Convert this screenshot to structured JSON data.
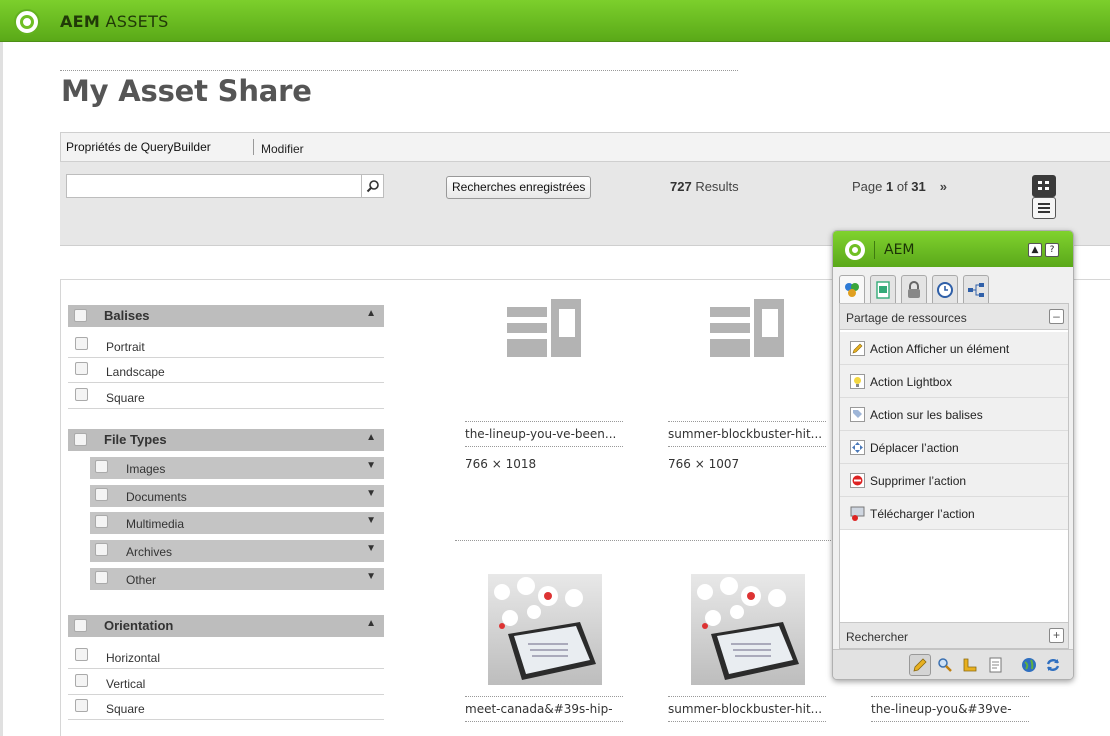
{
  "app": {
    "title_bold": "AEM",
    "title_rest": " ASSETS"
  },
  "page": {
    "title": "My Asset Share"
  },
  "query_builder": {
    "title": "Propriétés de QueryBuilder",
    "edit_label": "Modifier"
  },
  "search": {
    "value": "",
    "placeholder": "",
    "saved_searches_label": "Recherches enregistrées",
    "results_count": "727",
    "results_label": " Results",
    "page_prefix": "Page ",
    "page_current": "1",
    "page_of": " of ",
    "page_total": "31",
    "next_label": "»"
  },
  "facets": {
    "tags": {
      "label": "Balises",
      "items": [
        "Portrait",
        "Landscape",
        "Square"
      ]
    },
    "file_types": {
      "label": "File Types",
      "items": [
        "Images",
        "Documents",
        "Multimedia",
        "Archives",
        "Other"
      ]
    },
    "orientation": {
      "label": "Orientation",
      "items": [
        "Horizontal",
        "Vertical",
        "Square"
      ]
    }
  },
  "assets": [
    {
      "name": "the-lineup-you-ve-been...",
      "dims": "766 × 1018"
    },
    {
      "name": "summer-blockbuster-hit...",
      "dims": "766 × 1007"
    },
    {
      "name": "meet-canada&#39s-hip-"
    },
    {
      "name": "summer-blockbuster-hit..."
    },
    {
      "name": "the-lineup-you&#39ve-"
    }
  ],
  "sidekick": {
    "title": "AEM",
    "collapse_label": "▲",
    "help_label": "?",
    "tabs": [
      "components-icon",
      "page-icon",
      "lock-icon",
      "clock-icon",
      "workflow-icon"
    ],
    "section_label": "Partage de ressources",
    "section_toggle": "–",
    "actions": [
      {
        "label": "Action Afficher un élément",
        "icon": "pencil-icon"
      },
      {
        "label": "Action Lightbox",
        "icon": "lightbulb-icon"
      },
      {
        "label": "Action sur les balises",
        "icon": "tag-icon"
      },
      {
        "label": "Déplacer l’action",
        "icon": "move-icon"
      },
      {
        "label": "Supprimer l’action",
        "icon": "delete-icon"
      },
      {
        "label": "Télécharger l’action",
        "icon": "download-icon"
      }
    ],
    "search_section_label": "Rechercher",
    "search_toggle": "+",
    "tools": [
      "edit-mode-icon",
      "preview-icon",
      "ruler-icon",
      "page-properties-icon",
      "globe-icon",
      "refresh-icon"
    ]
  },
  "colors": {
    "brand_green": "#6fbf24",
    "facet_header": "#bdbdbd",
    "search_bg": "#e7e7e7"
  }
}
